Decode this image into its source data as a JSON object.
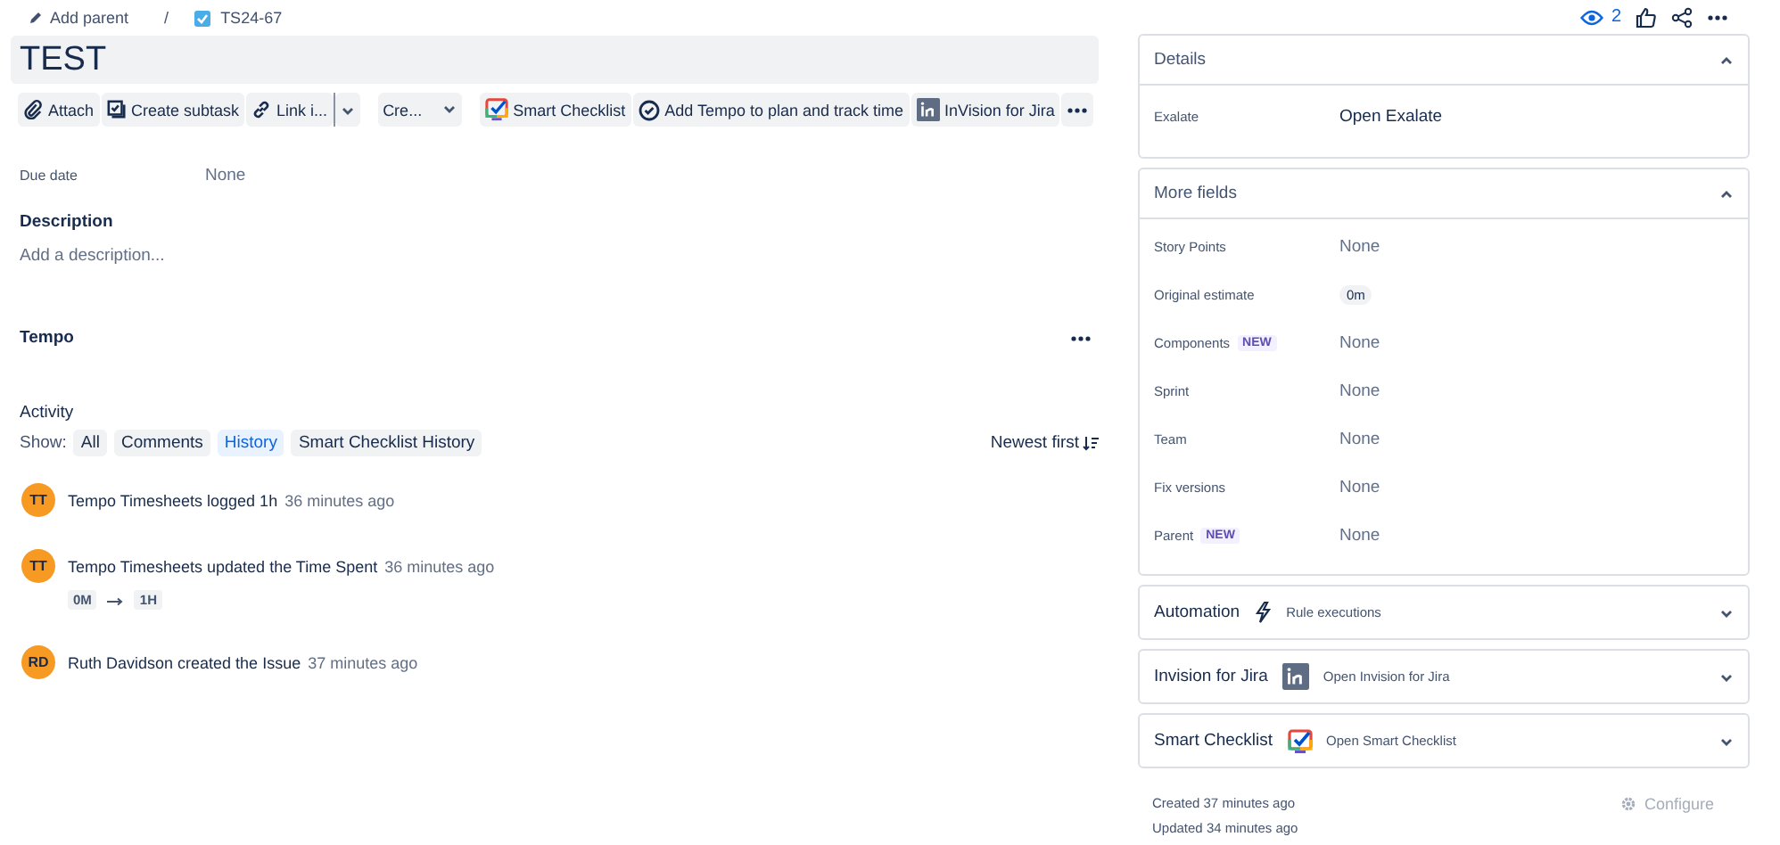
{
  "breadcrumb": {
    "parent_action": "Add parent",
    "separator": "/",
    "issue_key": "TS24-67"
  },
  "title": "TEST",
  "toolbar": [
    {
      "label": "Attach",
      "kind": "button"
    },
    {
      "label": "Create subtask",
      "kind": "button"
    },
    {
      "label": "Link i...",
      "kind": "split"
    },
    {
      "label": "Cre...",
      "kind": "dropdown"
    },
    {
      "label": "Smart Checklist",
      "kind": "button"
    },
    {
      "label": "Add Tempo to plan and track time",
      "kind": "button"
    },
    {
      "label": "InVision for Jira",
      "kind": "button"
    },
    {
      "kind": "more"
    }
  ],
  "due_date": {
    "label": "Due date",
    "value": "None"
  },
  "description": {
    "heading": "Description",
    "placeholder": "Add a description..."
  },
  "tempo": {
    "heading": "Tempo"
  },
  "activity": {
    "heading": "Activity",
    "show_label": "Show:",
    "sort": "Newest first",
    "filters": [
      {
        "label": "All",
        "selected": false
      },
      {
        "label": "Comments",
        "selected": false
      },
      {
        "label": "History",
        "selected": true
      },
      {
        "label": "Smart Checklist History",
        "selected": false
      }
    ],
    "entries": [
      {
        "initials": "TT",
        "text": "Tempo Timesheets logged 1h",
        "time": "36 minutes ago"
      },
      {
        "initials": "TT",
        "text": "Tempo Timesheets updated the Time Spent",
        "time": "36 minutes ago",
        "change": {
          "from": "0M",
          "to": "1H"
        }
      },
      {
        "initials": "RD",
        "text": "Ruth Davidson created the Issue",
        "time": "37 minutes ago"
      }
    ]
  },
  "header_actions": {
    "watchers": "2"
  },
  "panels": [
    {
      "title": "Details",
      "expanded": true,
      "fields": [
        {
          "label": "Exalate",
          "value": "Open Exalate",
          "kind": "link"
        }
      ]
    },
    {
      "title": "More fields",
      "expanded": true,
      "fields": [
        {
          "label": "Story Points",
          "value": "None",
          "kind": "text"
        },
        {
          "label": "Original estimate",
          "value": "0m",
          "kind": "chip"
        },
        {
          "label": "Components",
          "badge": "NEW",
          "value": "None",
          "kind": "text"
        },
        {
          "label": "Sprint",
          "value": "None",
          "kind": "text"
        },
        {
          "label": "Team",
          "value": "None",
          "kind": "text"
        },
        {
          "label": "Fix versions",
          "value": "None",
          "kind": "text"
        },
        {
          "label": "Parent",
          "badge": "NEW",
          "value": "None",
          "kind": "text"
        }
      ]
    },
    {
      "title": "Automation",
      "expanded": false,
      "link": "Rule executions",
      "kind": "automation"
    },
    {
      "title": "Invision for Jira",
      "expanded": false,
      "link": "Open Invision for Jira",
      "kind": "invision"
    },
    {
      "title": "Smart Checklist",
      "expanded": false,
      "link": "Open Smart Checklist",
      "kind": "checklist"
    }
  ],
  "footer": {
    "created": "Created 37 minutes ago",
    "updated": "Updated 34 minutes ago",
    "configure": "Configure"
  }
}
